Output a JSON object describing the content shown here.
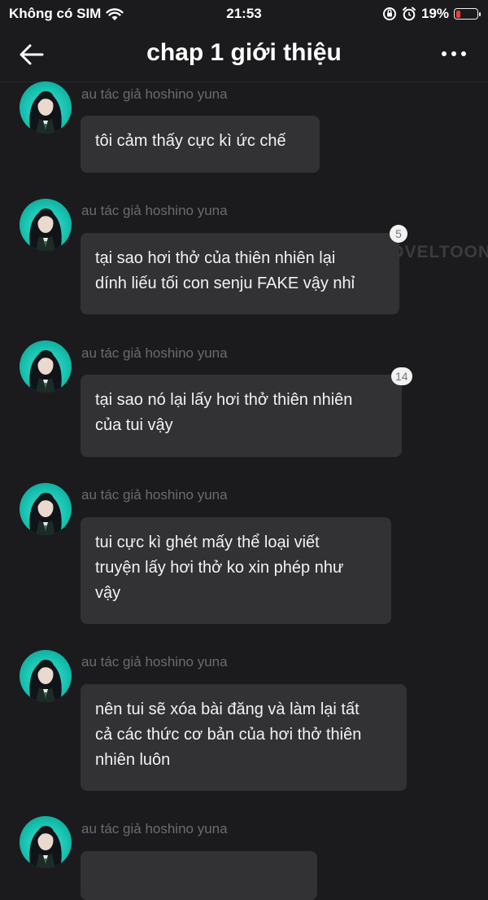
{
  "status_bar": {
    "carrier": "Không có SIM",
    "time": "21:53",
    "battery_percent": "19%",
    "battery_level": 0.19,
    "battery_color": "#ff3b30",
    "icons": [
      "wifi-icon",
      "orientation-lock-icon",
      "alarm-icon",
      "battery-icon"
    ]
  },
  "nav": {
    "title": "chap 1 giới thiệu",
    "back_icon": "back-arrow-icon",
    "more_icon": "more-options-icon"
  },
  "messages": [
    {
      "author": "au tác giả hoshino yuna",
      "text": "tôi cảm thấy cực kì ức chế",
      "comment_count": ""
    },
    {
      "author": "au tác giả hoshino yuna",
      "text": "tại sao hơi thở của thiên nhiên lại\ndính liếu tối con senju FAKE vậy nhỉ",
      "comment_count": "5"
    },
    {
      "author": "au tác giả hoshino yuna",
      "text": "tại sao nó lại lấy hơi thở thiên nhiên\ncủa tui vậy",
      "comment_count": "14"
    },
    {
      "author": "au tác giả hoshino yuna",
      "text": "tui cực kì ghét mấy thể loại viết\ntruyện lấy hơi thở ko xin phép như\nvậy",
      "comment_count": ""
    },
    {
      "author": "au tác giả hoshino yuna",
      "text": "nên tui sẽ xóa bài đăng và làm lại tất\ncả các thức cơ bản của hơi thở thiên\nnhiên luôn",
      "comment_count": ""
    },
    {
      "author": "au tác giả hoshino yuna",
      "text": "",
      "comment_count": ""
    }
  ],
  "watermark": "NOVELTOON",
  "colors": {
    "background": "#1b1b1d",
    "bubble": "#323234",
    "author_text": "#6b6b6f",
    "avatar_accent": "#18c3b1"
  }
}
